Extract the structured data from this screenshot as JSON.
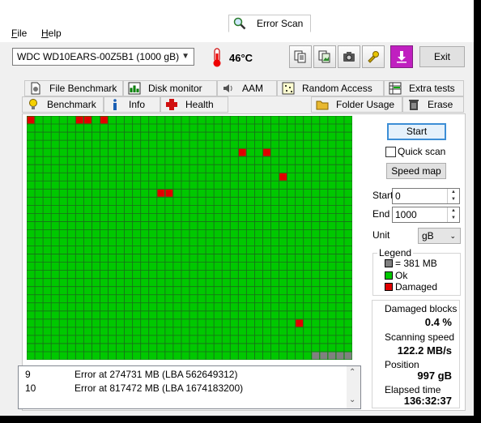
{
  "menu": {
    "file": "File",
    "help": "Help"
  },
  "toolbar": {
    "drive": "WDC WD10EARS-00Z5B1 (1000 gB)",
    "temperature": "46°C",
    "exit_label": "Exit"
  },
  "tabs_top": [
    {
      "label": "File Benchmark"
    },
    {
      "label": "Disk monitor"
    },
    {
      "label": "AAM"
    },
    {
      "label": "Random Access"
    },
    {
      "label": "Extra tests"
    }
  ],
  "tabs_bottom": [
    {
      "label": "Benchmark"
    },
    {
      "label": "Info"
    },
    {
      "label": "Health"
    },
    {
      "label": "Error Scan"
    },
    {
      "label": "Folder Usage"
    },
    {
      "label": "Erase"
    }
  ],
  "scan_grid": {
    "cols": 40,
    "rows": 30,
    "ok_color": "#00c800",
    "damaged_color": "#e00000",
    "pending_color": "#808080",
    "damaged_cells": [
      [
        0,
        0
      ],
      [
        0,
        6
      ],
      [
        0,
        7
      ],
      [
        0,
        9
      ],
      [
        4,
        26
      ],
      [
        4,
        29
      ],
      [
        7,
        31
      ],
      [
        9,
        16
      ],
      [
        9,
        17
      ],
      [
        25,
        33
      ]
    ],
    "pending_last_cells": 5
  },
  "controls": {
    "start_button": "Start",
    "quick_scan": "Quick scan",
    "speed_map_button": "Speed map",
    "start_label": "Start",
    "start_value": "0",
    "end_label": "End",
    "end_value": "1000",
    "unit_label": "Unit",
    "unit_value": "gB"
  },
  "legend": {
    "title": "Legend",
    "block_size": "= 381 MB",
    "ok": "Ok",
    "damaged": "Damaged"
  },
  "stats": {
    "damaged_label": "Damaged blocks",
    "damaged_value": "0.4 %",
    "speed_label": "Scanning speed",
    "speed_value": "122.2 MB/s",
    "position_label": "Position",
    "position_value": "997 gB",
    "elapsed_label": "Elapsed time",
    "elapsed_value": "136:32:37"
  },
  "log": [
    {
      "n": "9",
      "text": "Error at 274731 MB (LBA 562649312)"
    },
    {
      "n": "10",
      "text": "Error at 817472 MB (LBA 1674183200)"
    }
  ]
}
